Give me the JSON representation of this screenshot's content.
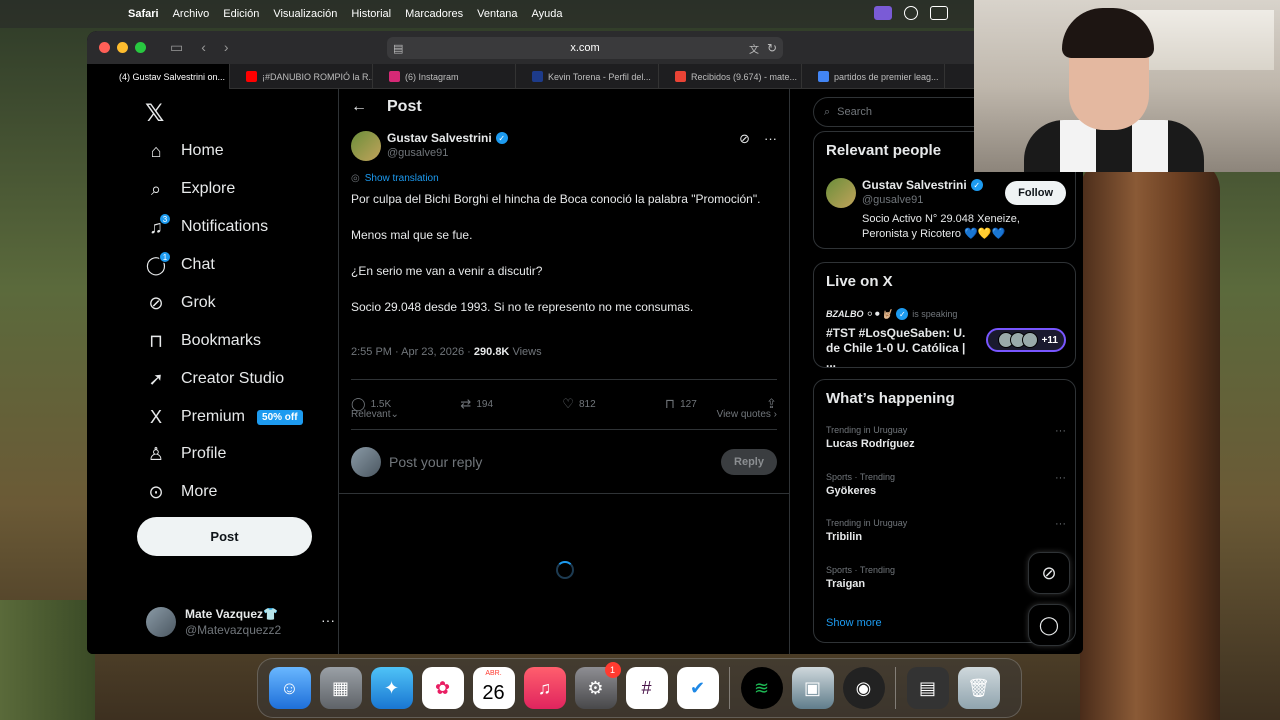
{
  "menubar": {
    "items": [
      "Safari",
      "Archivo",
      "Edición",
      "Visualización",
      "Historial",
      "Marcadores",
      "Ventana",
      "Ayuda"
    ]
  },
  "browser": {
    "url": "x.com",
    "tabs": [
      {
        "label": "(4) Gustav Salvestrini on...",
        "icon": "x-favicon",
        "color": "#000000"
      },
      {
        "label": "¡#DANUBIO ROMPIÓ la R...",
        "icon": "youtube-favicon",
        "color": "#ff0000"
      },
      {
        "label": "(6) Instagram",
        "icon": "instagram-favicon",
        "color": "#d62976"
      },
      {
        "label": "Kevin Torena - Perfil del...",
        "icon": "profile-favicon",
        "color": "#1d3b8a"
      },
      {
        "label": "Recibidos (9.674) - mate...",
        "icon": "gmail-favicon",
        "color": "#ea4335"
      },
      {
        "label": "partidos de premier leag...",
        "icon": "google-favicon",
        "color": "#4285f4"
      }
    ]
  },
  "nav": {
    "items": [
      {
        "label": "Home",
        "icon": "home-icon",
        "glyph": "⌂"
      },
      {
        "label": "Explore",
        "icon": "search-icon",
        "glyph": "⌕"
      },
      {
        "label": "Notifications",
        "icon": "bell-icon",
        "glyph": "♫",
        "badge": "3"
      },
      {
        "label": "Chat",
        "icon": "chat-icon",
        "glyph": "◯",
        "badge": "1"
      },
      {
        "label": "Grok",
        "icon": "grok-icon",
        "glyph": "⊘"
      },
      {
        "label": "Bookmarks",
        "icon": "bookmark-icon",
        "glyph": "⊓"
      },
      {
        "label": "Creator Studio",
        "icon": "rocket-icon",
        "glyph": "➚"
      },
      {
        "label": "Premium",
        "icon": "x-premium-icon",
        "glyph": "X",
        "badge_text": "50% off"
      },
      {
        "label": "Profile",
        "icon": "person-icon",
        "glyph": "♙"
      },
      {
        "label": "More",
        "icon": "more-circle-icon",
        "glyph": "⊙"
      }
    ],
    "post_label": "Post",
    "account": {
      "name": "Mate Vazquez👕",
      "handle": "@Matevazquezz2",
      "more": "···"
    }
  },
  "post": {
    "header": "Post",
    "author_name": "Gustav Salvestrini",
    "author_handle": "@gusalve91",
    "show_translation": "Show translation",
    "paragraphs": [
      "Por culpa del Bichi Borghi el hincha de Boca conoció la palabra \"Promoción\".",
      "Menos mal que se fue.",
      "¿En serio me van a venir a discutir?",
      "Socio 29.048 desde 1993. Si no te represento no me consumas."
    ],
    "time": "2:55 PM · Apr 23, 2026 · ",
    "views_count": "290.8K",
    "views_label": " Views",
    "actions": {
      "replies": "1.5K",
      "reposts": "194",
      "likes": "812",
      "bookmarks": "127"
    },
    "sort_label": "Relevant",
    "view_quotes": "View quotes",
    "reply_placeholder": "Post your reply",
    "reply_button": "Reply"
  },
  "sidebar": {
    "search_placeholder": "Search",
    "relevant_title": "Relevant people",
    "relevant_person": {
      "name": "Gustav Salvestrini",
      "handle": "@gusalve91",
      "bio": "Socio Activo N° 29.048 Xeneize, Peronista y Ricotero 💙💛💙",
      "follow": "Follow"
    },
    "live_title": "Live on X",
    "live": {
      "host": "BZALBO ⚪⚫🤘🏼",
      "status": "is speaking",
      "title": "#TST #LosQueSaben: U. de Chile 1-0 U. Católica | ...",
      "count": "+11"
    },
    "happening_title": "What’s happening",
    "trends": [
      {
        "meta": "Trending in Uruguay",
        "name": "Lucas Rodríguez"
      },
      {
        "meta": "Sports · Trending",
        "name": "Gyökeres"
      },
      {
        "meta": "Trending in Uruguay",
        "name": "Tribilin"
      },
      {
        "meta": "Sports · Trending",
        "name": "Traigan"
      }
    ],
    "show_more": "Show more"
  },
  "dock": {
    "calendar_month": "ABR.",
    "calendar_day": "26",
    "settings_badge": "1"
  }
}
